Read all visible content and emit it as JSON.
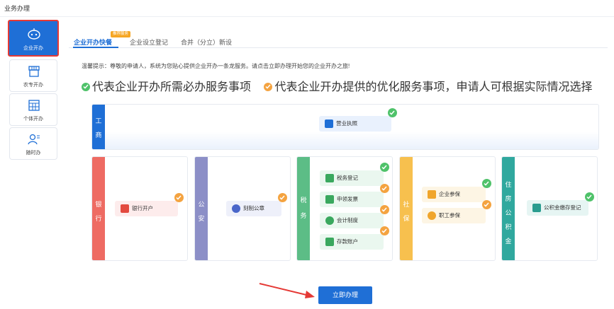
{
  "page": {
    "title": "业务办理"
  },
  "sidebar": {
    "items": [
      {
        "label": "企业开办",
        "icon": "robot-icon"
      },
      {
        "label": "农专开办",
        "icon": "shop-icon"
      },
      {
        "label": "个体开办",
        "icon": "store-icon"
      },
      {
        "label": "随时办",
        "icon": "user-card-icon"
      }
    ]
  },
  "tabs": {
    "items": [
      {
        "label": "企业开办快餐"
      },
      {
        "label": "企业设立登记"
      },
      {
        "label": "合并（分立）新设"
      }
    ],
    "badge": "推荐服务"
  },
  "tip": "温馨提示：尊敬的申请人，系统为您贴心提供企业开办一条龙服务。请点击立即办理开始您的企业开办之旅!",
  "legend": {
    "required": "代表企业开办所需必办服务事项",
    "optional": "代表企业开办提供的优化服务事项，申请人可根据实际情况选择"
  },
  "colors": {
    "green": "#4fc26a",
    "orange": "#f4a340",
    "blue": "#1f6fd6"
  },
  "panels": {
    "gongshang": {
      "title": "工商",
      "items": [
        "营业执照"
      ]
    },
    "bank": {
      "title": "银行",
      "items": [
        "银行开户"
      ]
    },
    "police": {
      "title": "公安",
      "items": [
        "刻制公章"
      ]
    },
    "tax": {
      "title": "税务",
      "items": [
        "税务登记",
        "申领发票",
        "会计制度",
        "存款账户"
      ]
    },
    "social": {
      "title": "社保",
      "items": [
        "企业参保",
        "职工参保"
      ]
    },
    "housing": {
      "title": "住房公积金",
      "items": [
        "公积金缴存登记"
      ]
    }
  },
  "action": {
    "label": "立即办理"
  }
}
